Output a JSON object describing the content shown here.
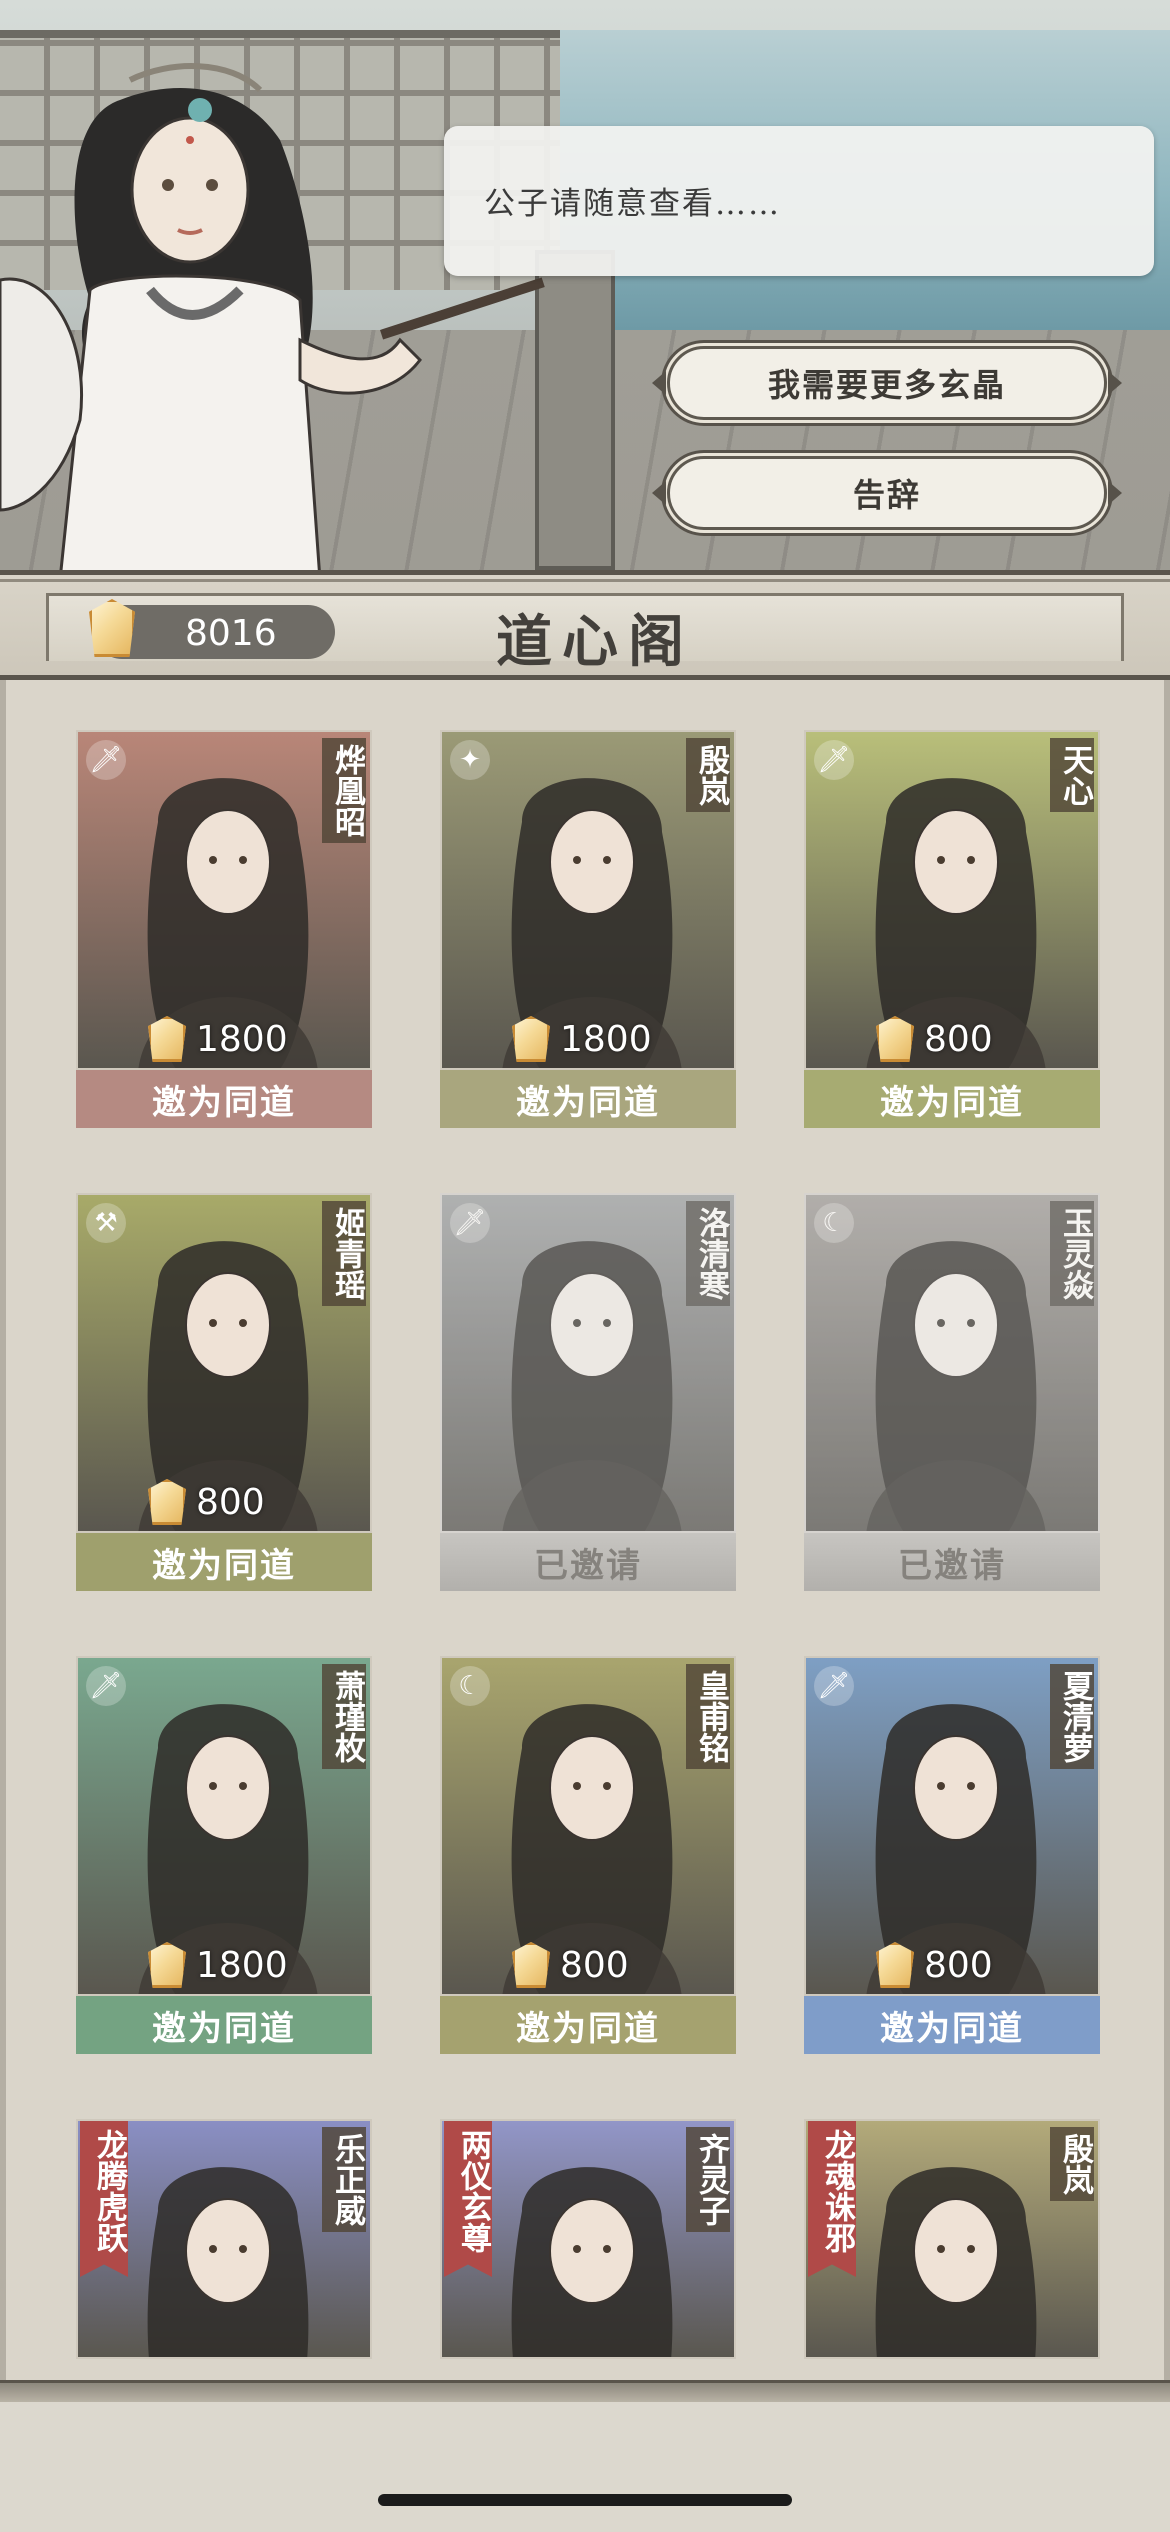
{
  "npc": {
    "dialog": "公子请随意查看……",
    "options": [
      "我需要更多玄晶",
      "告辞"
    ]
  },
  "header": {
    "currency_value": "8016",
    "title": "道心阁"
  },
  "cards": [
    {
      "name": "烨凰昭",
      "price": "1800",
      "button": "邀为同道",
      "status": "available",
      "color": "#b98678",
      "btn_color": "#b58a82",
      "icon": "sword-icon"
    },
    {
      "name": "殷岚",
      "price": "1800",
      "button": "邀为同道",
      "status": "available",
      "color": "#9b9a76",
      "btn_color": "#a9a67e",
      "icon": "spear-icon"
    },
    {
      "name": "天心",
      "price": "800",
      "button": "邀为同道",
      "status": "available",
      "color": "#b9bf7a",
      "btn_color": "#a7ab72",
      "icon": "sword-icon"
    },
    {
      "name": "姬青瑶",
      "price": "800",
      "button": "邀为同道",
      "status": "available",
      "color": "#a8aa69",
      "btn_color": "#9fa06d",
      "icon": "hammer-icon"
    },
    {
      "name": "洛清寒",
      "price": "",
      "button": "已邀请",
      "status": "invited",
      "color": "#8e9fb0",
      "btn_color": "#b9b8b4",
      "icon": "sword-icon"
    },
    {
      "name": "玉灵焱",
      "price": "",
      "button": "已邀请",
      "status": "invited",
      "color": "#a49892",
      "btn_color": "#b9b8b4",
      "icon": "moon-icon"
    },
    {
      "name": "萧瑾枚",
      "price": "1800",
      "button": "邀为同道",
      "status": "available",
      "color": "#7aa88f",
      "btn_color": "#74a382",
      "icon": "sword-icon"
    },
    {
      "name": "皇甫铭",
      "price": "800",
      "button": "邀为同道",
      "status": "available",
      "color": "#a9a56e",
      "btn_color": "#a5a26f",
      "icon": "moon-icon"
    },
    {
      "name": "夏清萝",
      "price": "800",
      "button": "邀为同道",
      "status": "available",
      "color": "#7e9fc4",
      "btn_color": "#7f9dc9",
      "icon": "sword-icon"
    },
    {
      "name": "乐正威",
      "price": "",
      "button": "",
      "status": "partial",
      "color": "#8a8fc4",
      "btn_color": "#8a8fc4",
      "icon": "",
      "banner": "龙腾虎跃"
    },
    {
      "name": "齐灵子",
      "price": "",
      "button": "",
      "status": "partial",
      "color": "#9296c8",
      "btn_color": "#9296c8",
      "icon": "",
      "banner": "两仪玄尊"
    },
    {
      "name": "殷岚",
      "price": "",
      "button": "",
      "status": "partial",
      "color": "#b3aa7a",
      "btn_color": "#b3aa7a",
      "icon": "",
      "banner": "龙魂诛邪"
    }
  ]
}
